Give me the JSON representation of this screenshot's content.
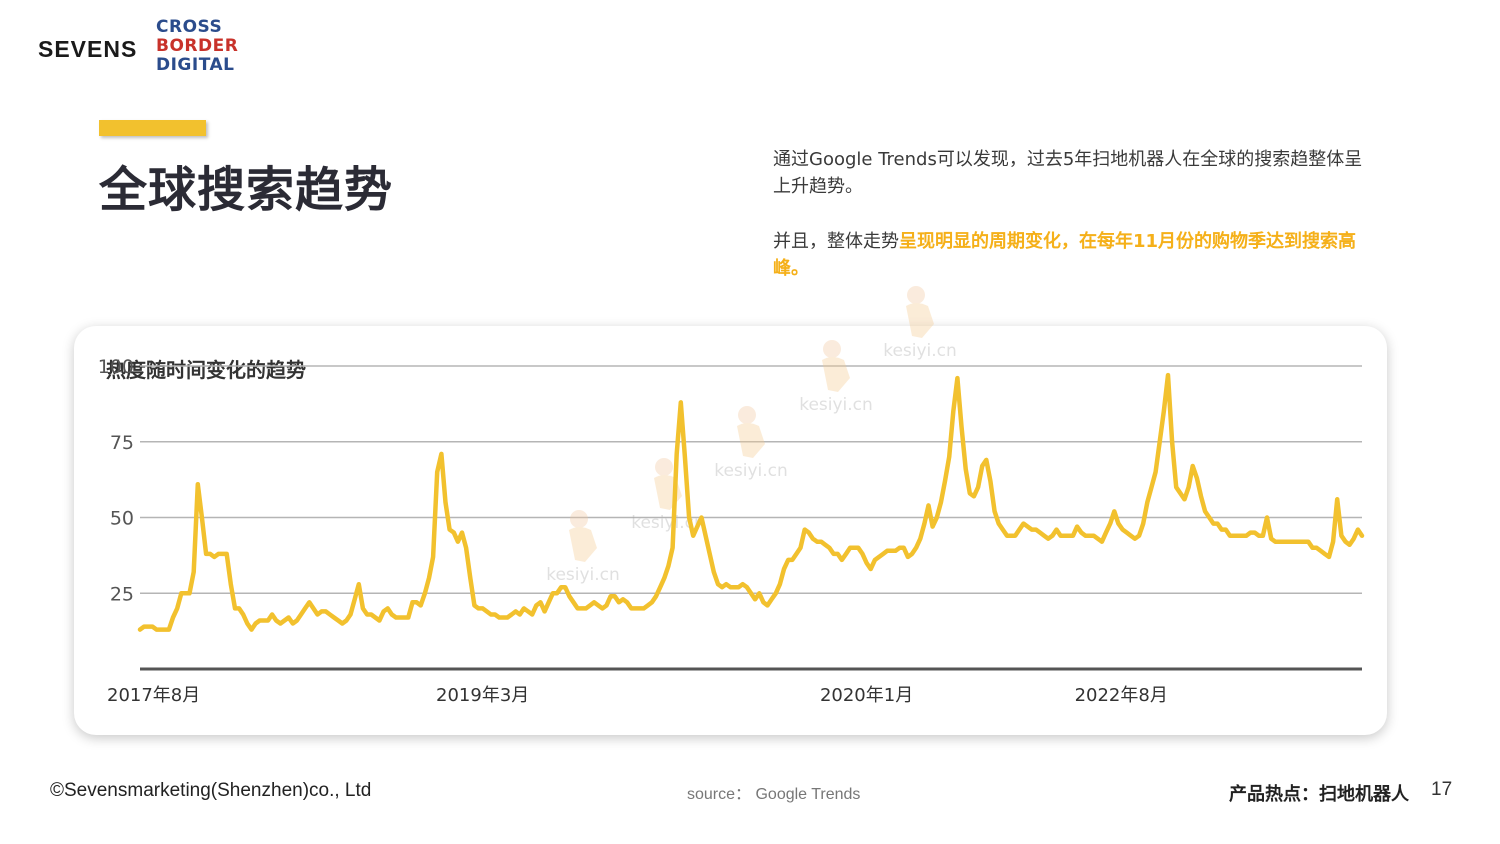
{
  "logo": {
    "sevens": "SEVENS",
    "cbd_line1": "CROSS",
    "cbd_line2": "BORDER",
    "cbd_line3": "DIGITAL"
  },
  "page": {
    "title": "全球搜索趋势",
    "desc_p1": "通过Google Trends可以发现，过去5年扫地机器人在全球的搜索趋整体呈上升趋势。",
    "desc_p2_prefix": "并且，整体走势",
    "desc_p2_highlight": "呈现明显的周期变化，在每年11月份的购物季达到搜索高峰。",
    "page_number": "17"
  },
  "footer": {
    "copyright": "©Sevensmarketing(Shenzhen)co., Ltd",
    "source": "source：  Google Trends",
    "topic": "产品热点：扫地机器人"
  },
  "colors": {
    "accent": "#f2c12e",
    "highlight_text": "#f5b019",
    "line": "#f2c12e",
    "grid": "#b5b5b5",
    "axis": "#555555"
  },
  "chart_data": {
    "type": "line",
    "title": "热度随时间变化的趋势",
    "y_ticks": [
      "25",
      "50",
      "75",
      "100"
    ],
    "y_tick_values": [
      25,
      50,
      75,
      100
    ],
    "x_tick_labels": [
      "2017年8月",
      "2019年3月",
      "2020年1月",
      "2022年8月"
    ],
    "x_tick_index": [
      0,
      83,
      176,
      248
    ],
    "ylim": [
      0,
      100
    ],
    "grid": true,
    "series": [
      {
        "values": [
          13,
          14,
          14,
          14,
          13,
          13,
          13,
          13,
          17,
          20,
          25,
          25,
          25,
          32,
          61,
          50,
          38,
          38,
          37,
          38,
          38,
          38,
          28,
          20,
          20,
          18,
          15,
          13,
          15,
          16,
          16,
          16,
          18,
          16,
          15,
          16,
          17,
          15,
          16,
          18,
          20,
          22,
          20,
          18,
          19,
          19,
          18,
          17,
          16,
          15,
          16,
          18,
          23,
          28,
          20,
          18,
          18,
          17,
          16,
          19,
          20,
          18,
          17,
          17,
          17,
          17,
          22,
          22,
          21,
          25,
          30,
          37,
          65,
          71,
          55,
          46,
          45,
          42,
          45,
          40,
          30,
          21,
          20,
          20,
          19,
          18,
          18,
          17,
          17,
          17,
          18,
          19,
          18,
          20,
          19,
          18,
          21,
          22,
          19,
          22,
          25,
          25,
          27,
          27,
          24,
          22,
          20,
          20,
          20,
          21,
          22,
          21,
          20,
          21,
          24,
          24,
          22,
          23,
          22,
          20,
          20,
          20,
          20,
          21,
          22,
          24,
          27,
          30,
          34,
          40,
          71,
          88,
          70,
          50,
          44,
          47,
          50,
          44,
          38,
          32,
          28,
          27,
          28,
          27,
          27,
          27,
          28,
          27,
          25,
          23,
          25,
          22,
          21,
          23,
          25,
          28,
          33,
          36,
          36,
          38,
          40,
          46,
          45,
          43,
          42,
          42,
          41,
          40,
          38,
          38,
          36,
          38,
          40,
          40,
          40,
          38,
          35,
          33,
          36,
          37,
          38,
          39,
          39,
          39,
          40,
          40,
          37,
          38,
          40,
          43,
          48,
          54,
          47,
          50,
          55,
          62,
          70,
          85,
          96,
          80,
          66,
          58,
          57,
          60,
          67,
          69,
          62,
          52,
          48,
          46,
          44,
          44,
          44,
          46,
          48,
          47,
          46,
          46,
          45,
          44,
          43,
          44,
          46,
          44,
          44,
          44,
          44,
          47,
          45,
          44,
          44,
          44,
          43,
          42,
          45,
          48,
          52,
          48,
          46,
          45,
          44,
          43,
          44,
          48,
          55,
          60,
          65,
          75,
          85,
          97,
          75,
          60,
          58,
          56,
          60,
          67,
          63,
          57,
          52,
          50,
          48,
          48,
          46,
          46,
          44,
          44,
          44,
          44,
          44,
          45,
          45,
          44,
          44,
          50,
          43,
          42,
          42,
          42,
          42,
          42,
          42,
          42,
          42,
          42,
          40,
          40,
          39,
          38,
          37,
          42,
          56,
          44,
          42,
          41,
          43,
          46,
          44
        ]
      }
    ]
  },
  "watermark": {
    "text": "kesiyi.cn"
  }
}
